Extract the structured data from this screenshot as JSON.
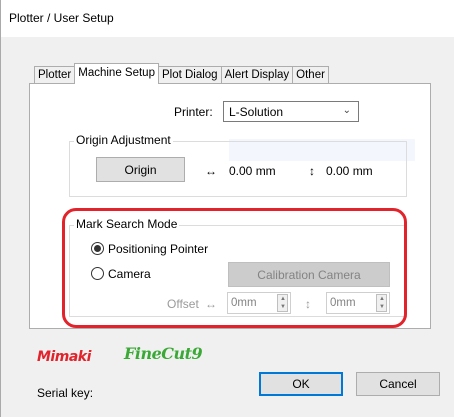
{
  "window": {
    "title": "Plotter / User Setup"
  },
  "tabs": [
    "Plotter",
    "Machine Setup",
    "Plot Dialog",
    "Alert Display",
    "Other"
  ],
  "printer": {
    "label": "Printer:",
    "value": "L-Solution"
  },
  "origin_adjustment": {
    "legend": "Origin Adjustment",
    "button": "Origin",
    "x_arrow": "↔",
    "x_value": "0.00 mm",
    "y_arrow": "↕",
    "y_value": "0.00 mm"
  },
  "mark_search": {
    "legend": "Mark Search Mode",
    "option_pointer": "Positioning Pointer",
    "option_camera": "Camera",
    "selected": "Positioning Pointer",
    "calibration_button": "Calibration Camera",
    "offset_label": "Offset",
    "offset_x_arrow": "↔",
    "offset_x_value": "0mm",
    "offset_y_arrow": "↕",
    "offset_y_value": "0mm",
    "highlight_color": "#e2232b"
  },
  "footer": {
    "brand": "Mimaki",
    "product": "FineCut9",
    "serial_label": "Serial key:",
    "ok": "OK",
    "cancel": "Cancel"
  }
}
